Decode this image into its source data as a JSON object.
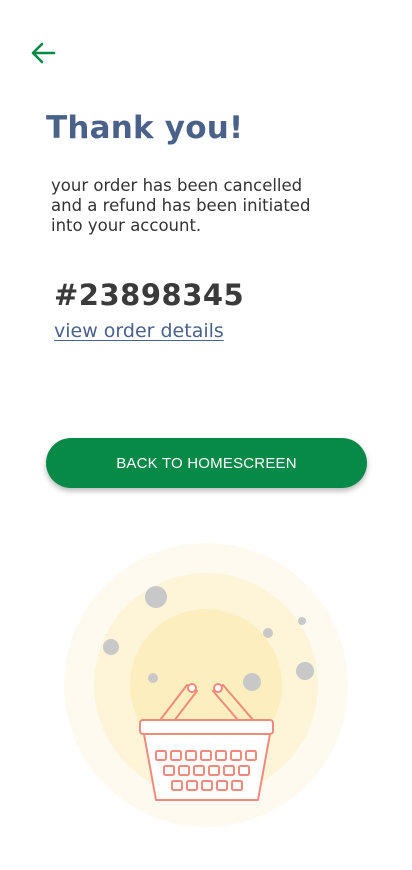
{
  "header": {
    "back_icon": "arrow-left-icon",
    "accent_color": "#078a47"
  },
  "confirmation": {
    "title": "Thank you!",
    "message": "your order has been cancelled\nand a refund has been initiated\ninto your account.",
    "order_number": "#23898345",
    "details_link": "view order details"
  },
  "actions": {
    "home_button_label": "BACK TO HOMESCREEN"
  },
  "illustration": {
    "icon": "shopping-basket-icon",
    "glow_colors": [
      "#fffaf0",
      "#fef4d8",
      "#fdeec0"
    ],
    "basket_color": "#f08a7c",
    "bubble_color": "#c8c8c8"
  }
}
